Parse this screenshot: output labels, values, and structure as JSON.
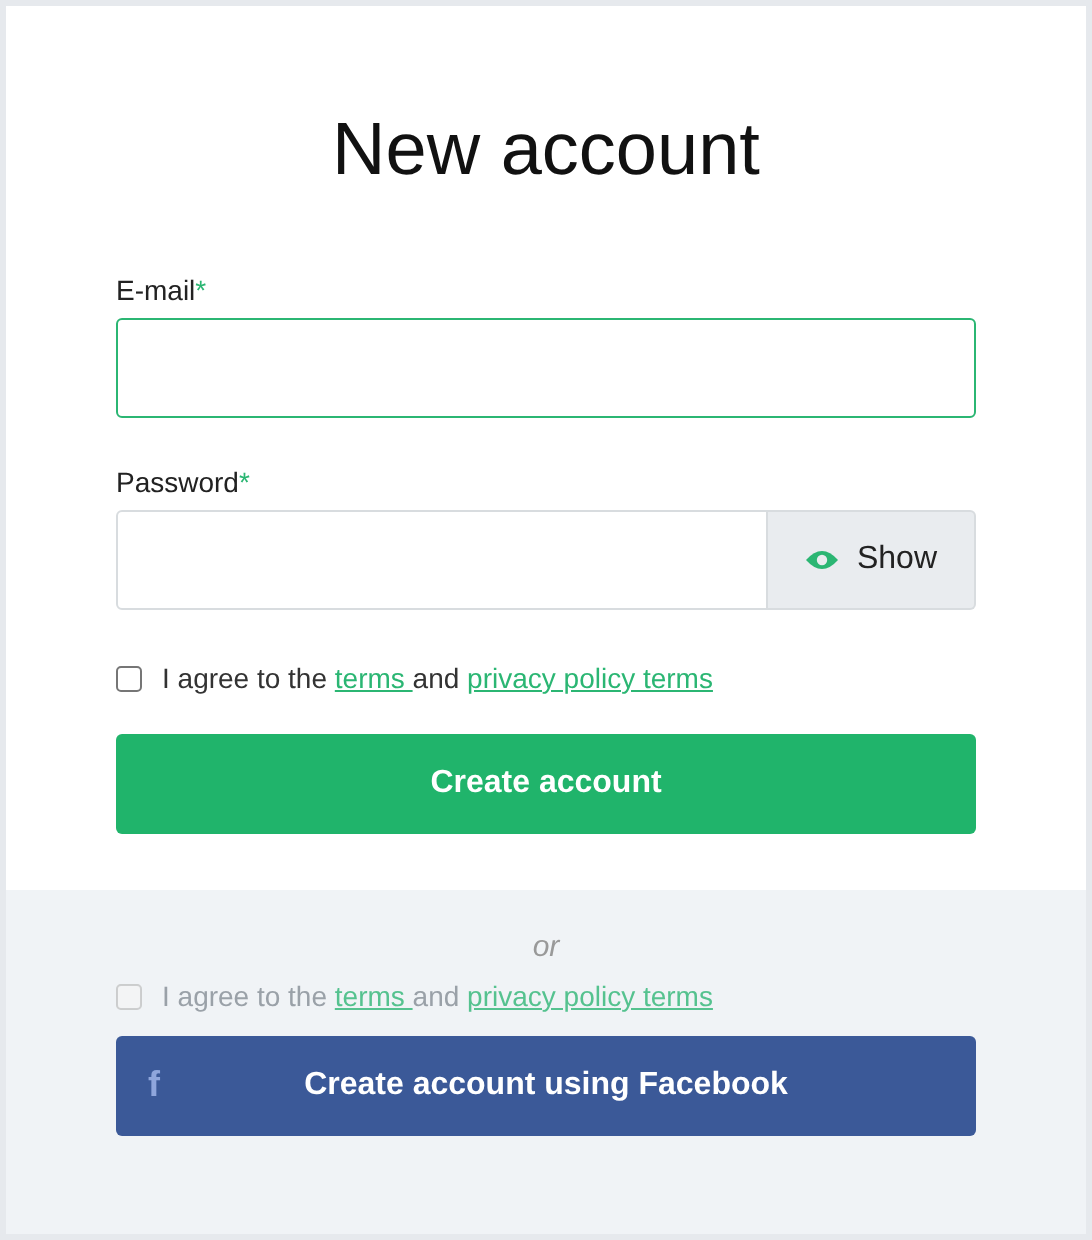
{
  "title": "New account",
  "fields": [
    {
      "kind": "text",
      "label": "E-mail",
      "required_mark": "*",
      "focused": true
    },
    {
      "kind": "password",
      "label": "Password",
      "required_mark": "*",
      "focused": false,
      "toggle": "Show"
    }
  ],
  "agreements": [
    {
      "before": "I agree to the ",
      "link1": "terms ",
      "middle": "and ",
      "link2": "privacy policy terms",
      "checked": false,
      "disabled": false
    },
    {
      "before": "I agree to the ",
      "link1": "terms ",
      "middle": "and ",
      "link2": "privacy policy terms",
      "checked": false,
      "disabled": true
    }
  ],
  "submit": "Create account",
  "divider": "or",
  "social_button": {
    "icon": "f",
    "label": "Create account using Facebook"
  }
}
